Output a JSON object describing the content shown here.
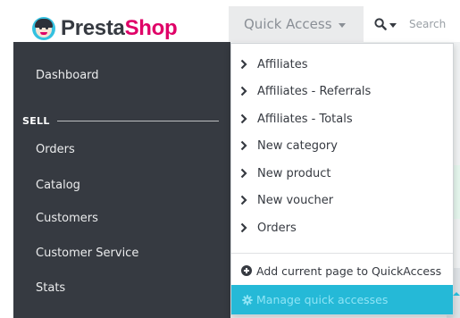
{
  "header": {
    "logo_word_1": "Presta",
    "logo_word_2": "Shop",
    "quick_access_label": "Quick Access",
    "search_placeholder": "Search"
  },
  "sidebar": {
    "dashboard": "Dashboard",
    "section_label": "SELL",
    "items": [
      "Orders",
      "Catalog",
      "Customers",
      "Customer Service",
      "Stats"
    ]
  },
  "dropdown": {
    "links": [
      "Affiliates",
      "Affiliates - Referrals",
      "Affiliates - Totals",
      "New category",
      "New product",
      "New voucher",
      "Orders"
    ],
    "add_current": "Add current page to QuickAccess",
    "manage": "Manage quick accesses"
  },
  "colors": {
    "sidebar_bg": "#363a41",
    "brand_pink": "#df0067",
    "accent_blue": "#25b9d7"
  }
}
